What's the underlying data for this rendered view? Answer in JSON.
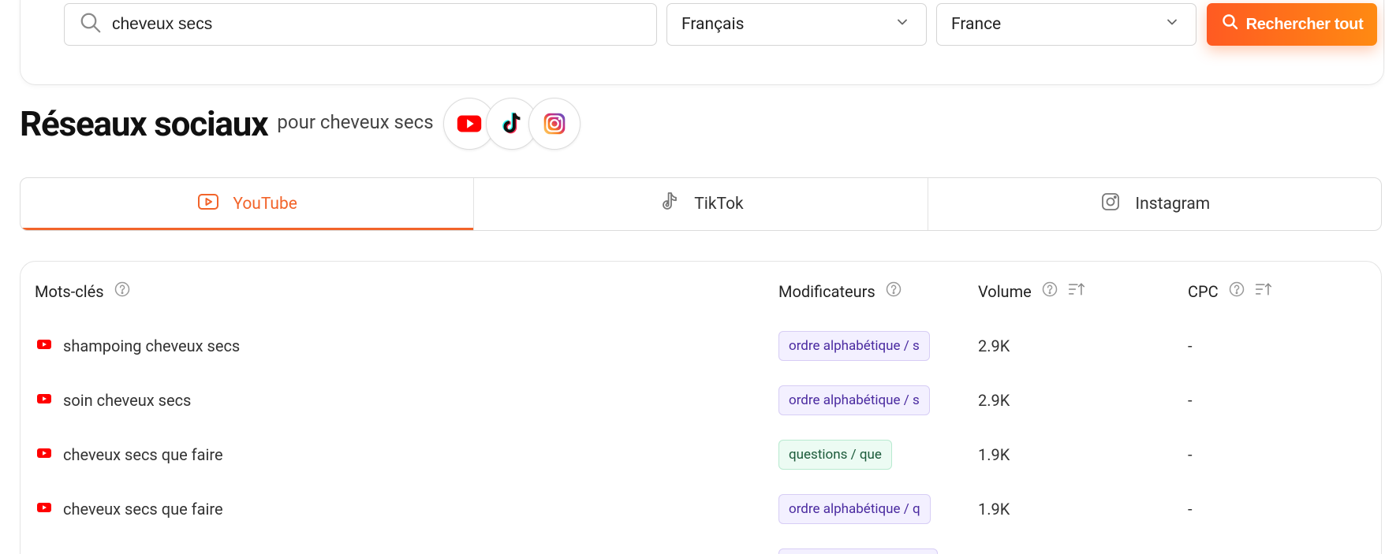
{
  "search": {
    "query": "cheveux secs",
    "language": "Français",
    "country": "France",
    "button_label": "Rechercher tout"
  },
  "header": {
    "title": "Réseaux sociaux",
    "subtitle": "pour cheveux secs",
    "social_icons": [
      "youtube-icon",
      "tiktok-icon",
      "instagram-icon"
    ]
  },
  "tabs": [
    {
      "label": "YouTube",
      "icon": "youtube-outline-icon",
      "active": true
    },
    {
      "label": "TikTok",
      "icon": "tiktok-outline-icon",
      "active": false
    },
    {
      "label": "Instagram",
      "icon": "instagram-outline-icon",
      "active": false
    }
  ],
  "table": {
    "columns": {
      "keywords": "Mots-clés",
      "modifiers": "Modificateurs",
      "volume": "Volume",
      "cpc": "CPC"
    },
    "rows": [
      {
        "keyword": "shampoing cheveux secs",
        "modifier": "ordre alphabétique / s",
        "modifier_type": "purple",
        "volume": "2.9K",
        "cpc": "-"
      },
      {
        "keyword": "soin cheveux secs",
        "modifier": "ordre alphabétique / s",
        "modifier_type": "purple",
        "volume": "2.9K",
        "cpc": "-"
      },
      {
        "keyword": "cheveux secs que faire",
        "modifier": "questions / que",
        "modifier_type": "green",
        "volume": "1.9K",
        "cpc": "-"
      },
      {
        "keyword": "cheveux secs que faire",
        "modifier": "ordre alphabétique / q",
        "modifier_type": "purple",
        "volume": "1.9K",
        "cpc": "-"
      }
    ]
  },
  "colors": {
    "accent": "#f2642a",
    "youtube_red": "#ff0000"
  }
}
